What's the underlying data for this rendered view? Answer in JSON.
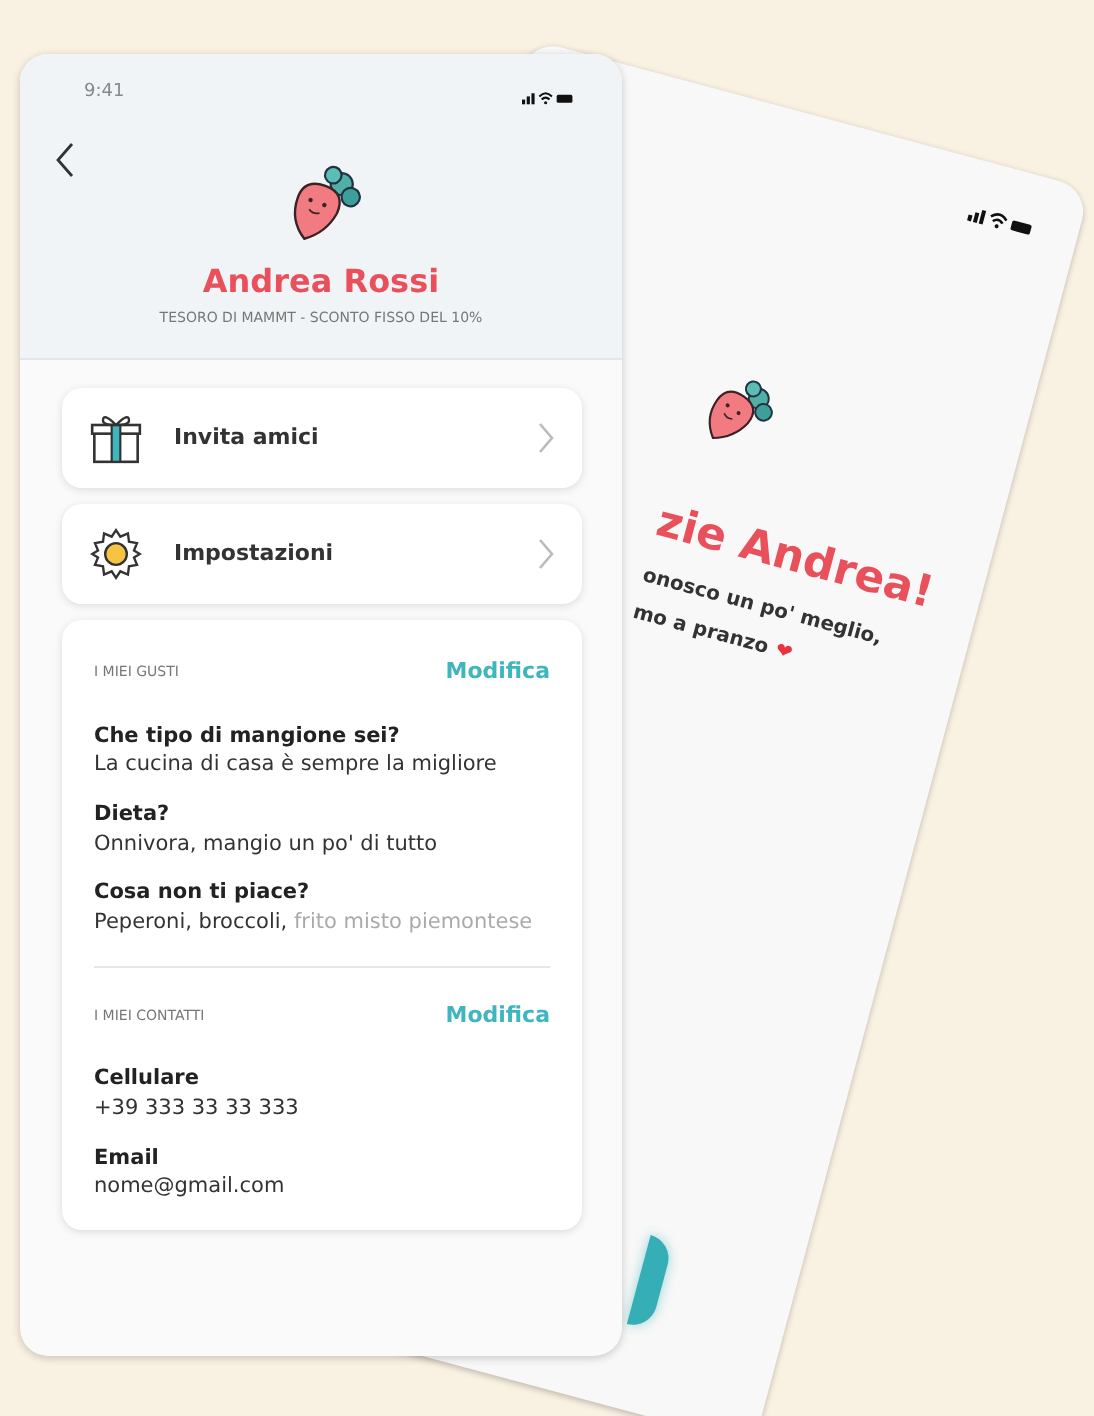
{
  "status_bar": {
    "time": "9:41"
  },
  "profile": {
    "name": "Andrea Rossi",
    "subtitle": "TESORO DI MAMMT - SCONTO FISSO DEL 10%"
  },
  "menu": [
    {
      "label": "Invita amici",
      "kind": "gift"
    },
    {
      "label": "Impostazioni",
      "kind": "gear"
    }
  ],
  "sections": [
    {
      "title": "I MIEI GUSTI",
      "action": "Modifica",
      "fields": [
        {
          "label": "Che tipo di mangione sei?",
          "value": "La cucina di casa è sempre la migliore"
        },
        {
          "label": "Dieta?",
          "value": "Onnivora, mangio un po' di tutto"
        },
        {
          "label": "Cosa non ti piace?",
          "value": "Peperoni, broccoli,",
          "value_faded": "frito misto piemontese"
        }
      ]
    },
    {
      "title": "I MIEI CONTATTI",
      "action": "Modifica",
      "fields": [
        {
          "label": "Cellulare",
          "value": "+39 333 33 33 333"
        },
        {
          "label": "Email",
          "value": "nome@gmail.com"
        }
      ]
    }
  ],
  "back_screen": {
    "title": "zie Andrea!",
    "lines": [
      "onosco un po' meglio,",
      "mo a pranzo"
    ],
    "heart": "❤"
  }
}
